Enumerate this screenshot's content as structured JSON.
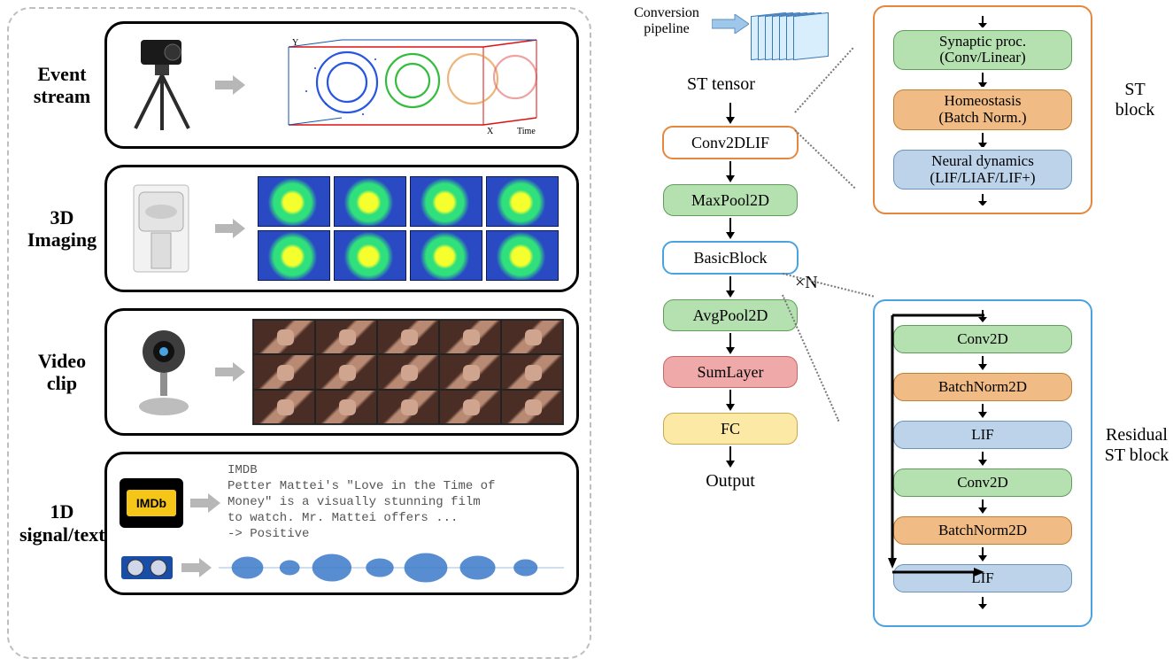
{
  "left": {
    "rows": [
      {
        "label": "Event\nstream",
        "axis_y": "Y",
        "axis_x": "X",
        "axis_time": "Time"
      },
      {
        "label": "3D\nImaging"
      },
      {
        "label": "Video\nclip"
      },
      {
        "label": "1D\nsignal/text"
      }
    ],
    "imdb": {
      "logo": "IMDb",
      "text": "IMDB\nPetter Mattei's \"Love in the Time of\nMoney\" is a visually stunning film\nto watch. Mr. Mattei offers ...\n-> Positive"
    }
  },
  "center": {
    "conversion_label": "Conversion\npipeline",
    "st_tensor_label": "ST tensor",
    "nodes": {
      "conv2dlif": "Conv2DLIF",
      "maxpool": "MaxPool2D",
      "basicblock": "BasicBlock",
      "avgpool": "AvgPool2D",
      "sumlayer": "SumLayer",
      "fc": "FC"
    },
    "xn": "×N",
    "output": "Output"
  },
  "right": {
    "st_block_label": "ST\nblock",
    "res_block_label": "Residual\nST block",
    "st": {
      "syn1": "Synaptic proc.",
      "syn2": "(Conv/Linear)",
      "hom1": "Homeostasis",
      "hom2": "(Batch Norm.)",
      "neu1": "Neural dynamics",
      "neu2": "(LIF/LIAF/LIF+)"
    },
    "res": {
      "conv2d": "Conv2D",
      "bn2d": "BatchNorm2D",
      "lif": "LIF"
    }
  }
}
